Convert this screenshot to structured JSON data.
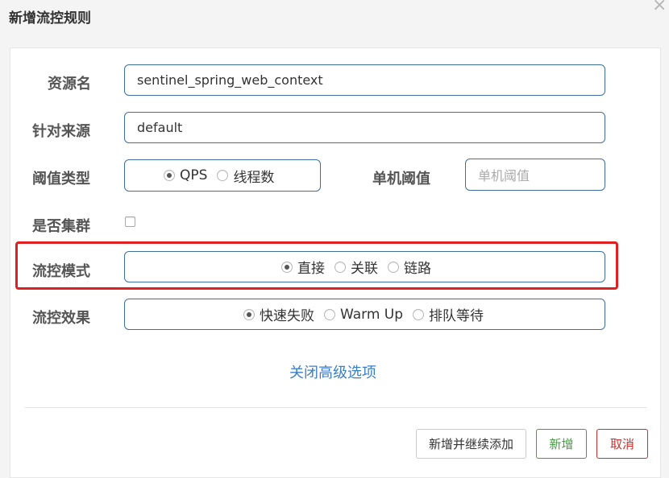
{
  "dialog": {
    "title": "新增流控规则"
  },
  "form": {
    "resource_name": {
      "label": "资源名",
      "value": "sentinel_spring_web_context"
    },
    "limit_app": {
      "label": "针对来源",
      "value": "default"
    },
    "threshold_type": {
      "label": "阈值类型",
      "options": [
        "QPS",
        "线程数"
      ],
      "selected": "QPS"
    },
    "single_threshold": {
      "label": "单机阈值",
      "placeholder": "单机阈值",
      "value": ""
    },
    "cluster": {
      "label": "是否集群",
      "checked": false
    },
    "flow_mode": {
      "label": "流控模式",
      "options": [
        "直接",
        "关联",
        "链路"
      ],
      "selected": "直接"
    },
    "control_behavior": {
      "label": "流控效果",
      "options": [
        "快速失败",
        "Warm Up",
        "排队等待"
      ],
      "selected": "快速失败"
    },
    "advanced_link": "关闭高级选项"
  },
  "footer": {
    "add_continue_label": "新增并继续添加",
    "add_label": "新增",
    "cancel_label": "取消"
  },
  "colors": {
    "border": "#3d6f9f",
    "highlight": "#e02020",
    "link": "#3a7fc4",
    "success": "#449d44",
    "danger": "#c9302c"
  }
}
